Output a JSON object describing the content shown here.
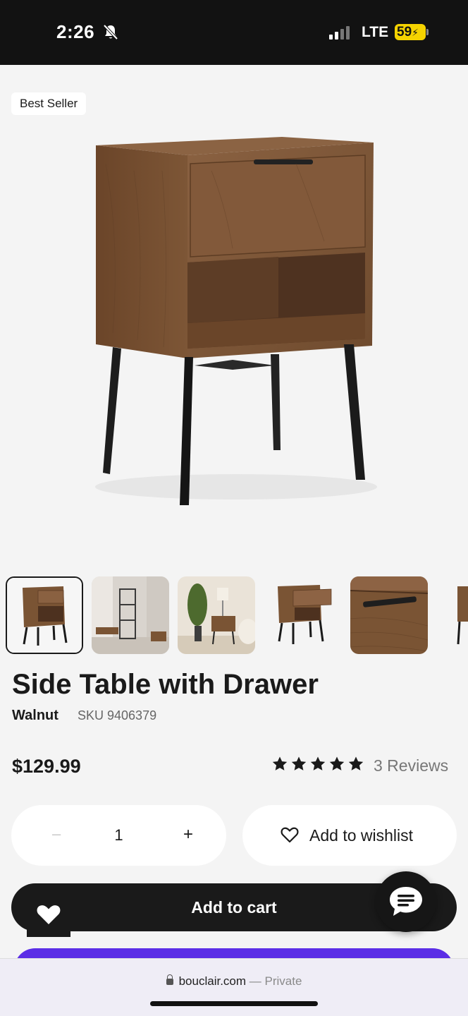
{
  "status_bar": {
    "time": "2:26",
    "network": "LTE",
    "battery": "59",
    "icons": [
      "bell-off-icon",
      "signal-icon",
      "battery-charging-icon"
    ]
  },
  "product": {
    "badge": "Best Seller",
    "title": "Side Table with Drawer",
    "variant": "Walnut",
    "sku": "SKU 9406379",
    "price": "$129.99",
    "rating": 5,
    "reviews": "3 Reviews"
  },
  "quantity": {
    "minus": "–",
    "value": "1",
    "plus": "+"
  },
  "actions": {
    "wishlist": "Add to wishlist",
    "add_to_cart": "Add to cart"
  },
  "browser": {
    "domain": "bouclair.com",
    "separator": " — ",
    "mode": "Private"
  },
  "colors": {
    "status_bg": "#121212",
    "battery": "#f5d300",
    "cart_bg": "#1a1a1a",
    "purple": "#5b2ee6",
    "wood": "#7a5434"
  }
}
